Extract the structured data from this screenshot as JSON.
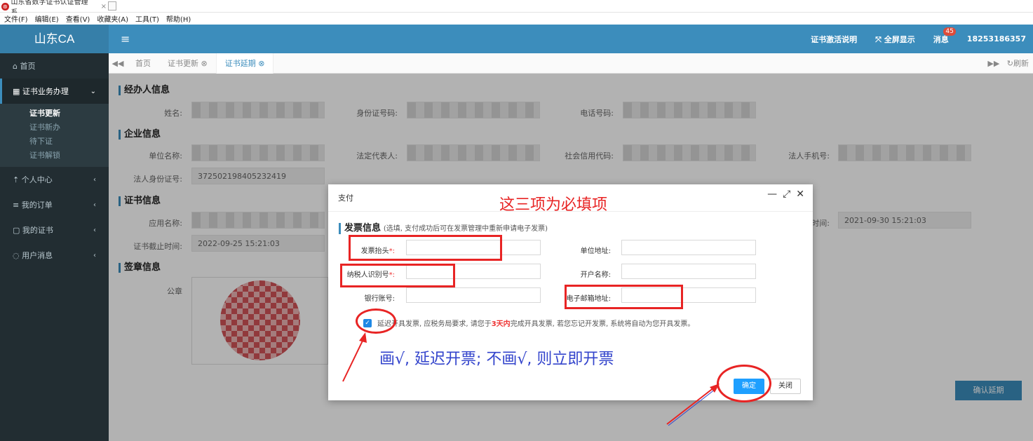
{
  "browser": {
    "tab_title": "山东省数字证书认证管理系...",
    "close_glyph": "×",
    "menu": [
      "文件(F)",
      "编辑(E)",
      "查看(V)",
      "收藏夹(A)",
      "工具(T)",
      "帮助(H)"
    ]
  },
  "header": {
    "logo": "山东CA",
    "menu_glyph": "≡",
    "activation_help": "证书激活说明",
    "fullscreen": "全屏显示",
    "messages": "消息",
    "message_count": "45",
    "user_phone": "18253186357"
  },
  "sidebar": {
    "home": "首页",
    "business": "证书业务办理",
    "sub_items": [
      "证书更新",
      "证书新办",
      "待下证",
      "证书解锁"
    ],
    "personal": "个人中心",
    "orders": "我的订单",
    "certs": "我的证书",
    "user_msgs": "用户消息"
  },
  "content_tabs": {
    "home": "首页",
    "update": "证书更新",
    "extend": "证书延期",
    "refresh": "刷新"
  },
  "main": {
    "agent_section": "经办人信息",
    "agent_name_label": "姓名:",
    "agent_id_label": "身份证号码:",
    "agent_phone_label": "电话号码:",
    "company_section": "企业信息",
    "company_name_label": "单位名称:",
    "legal_rep_label": "法定代表人:",
    "credit_code_label": "社会信用代码:",
    "legal_phone_label": "法人手机号:",
    "legal_id_label": "法人身份证号:",
    "legal_id_value": "372502198405232419",
    "cert_section": "证书信息",
    "app_name_label": "应用名称:",
    "time_label_right": "时间:",
    "time_value_right": "2021-09-30 15:21:03",
    "cert_expire_label": "证书截止时间:",
    "cert_expire_value": "2022-09-25 15:21:03",
    "seal_section": "签章信息",
    "seal_label": "公章",
    "confirm_extend": "确认延期"
  },
  "dialog": {
    "title": "支付",
    "section_title": "发票信息",
    "section_note": "(选填, 支付成功后可在发票管理中重新申请电子发票)",
    "invoice_title_label": "发票抬头",
    "taxpayer_id_label": "纳税人识别号",
    "bank_account_label": "银行账号:",
    "company_address_label": "单位地址:",
    "account_name_label": "开户名称:",
    "email_label": "电子邮箱地址:",
    "required_mark": "*:",
    "delay_text_1": "延迟开具发票, 应税务局要求, 请您于",
    "delay_text_hi": "3天内",
    "delay_text_2": "完成开具发票, 若您忘记开发票, 系统将自动为您开具发票。",
    "ok": "确定",
    "close": "关闭"
  },
  "annotations": {
    "required_note": "这三项为必填项",
    "check_note": "画√, 延迟开票; 不画√, 则立即开票",
    "red": "#e82424",
    "blue": "#3344cc"
  },
  "colors": {
    "header": "#3c8dbc",
    "sidebar": "#222d32",
    "primary_btn": "#1e9fff"
  }
}
